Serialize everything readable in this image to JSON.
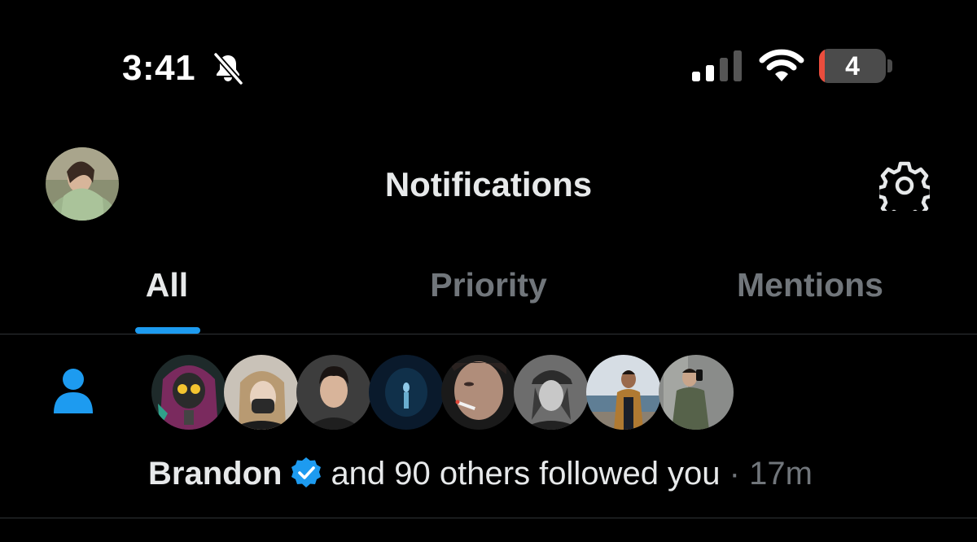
{
  "status_bar": {
    "time": "3:41",
    "battery_level": "4",
    "battery_fraction": 0.04
  },
  "header": {
    "title": "Notifications",
    "settings_icon": "gear-icon",
    "avatar_icon": "profile-avatar"
  },
  "tabs": [
    {
      "label": "All",
      "active": true
    },
    {
      "label": "Priority",
      "active": false
    },
    {
      "label": "Mentions",
      "active": false
    }
  ],
  "notification": {
    "type_icon": "person-icon",
    "name": "Brandon",
    "verified": true,
    "text": "and 90 others followed you",
    "separator": " · ",
    "time": "17m",
    "follower_avatar_count": 8
  },
  "colors": {
    "background": "#000000",
    "primary_text": "#e7e9ea",
    "secondary_text": "#71767b",
    "accent": "#1d9bf0",
    "divider": "#2f3336",
    "battery_low": "#eb4d3d"
  }
}
